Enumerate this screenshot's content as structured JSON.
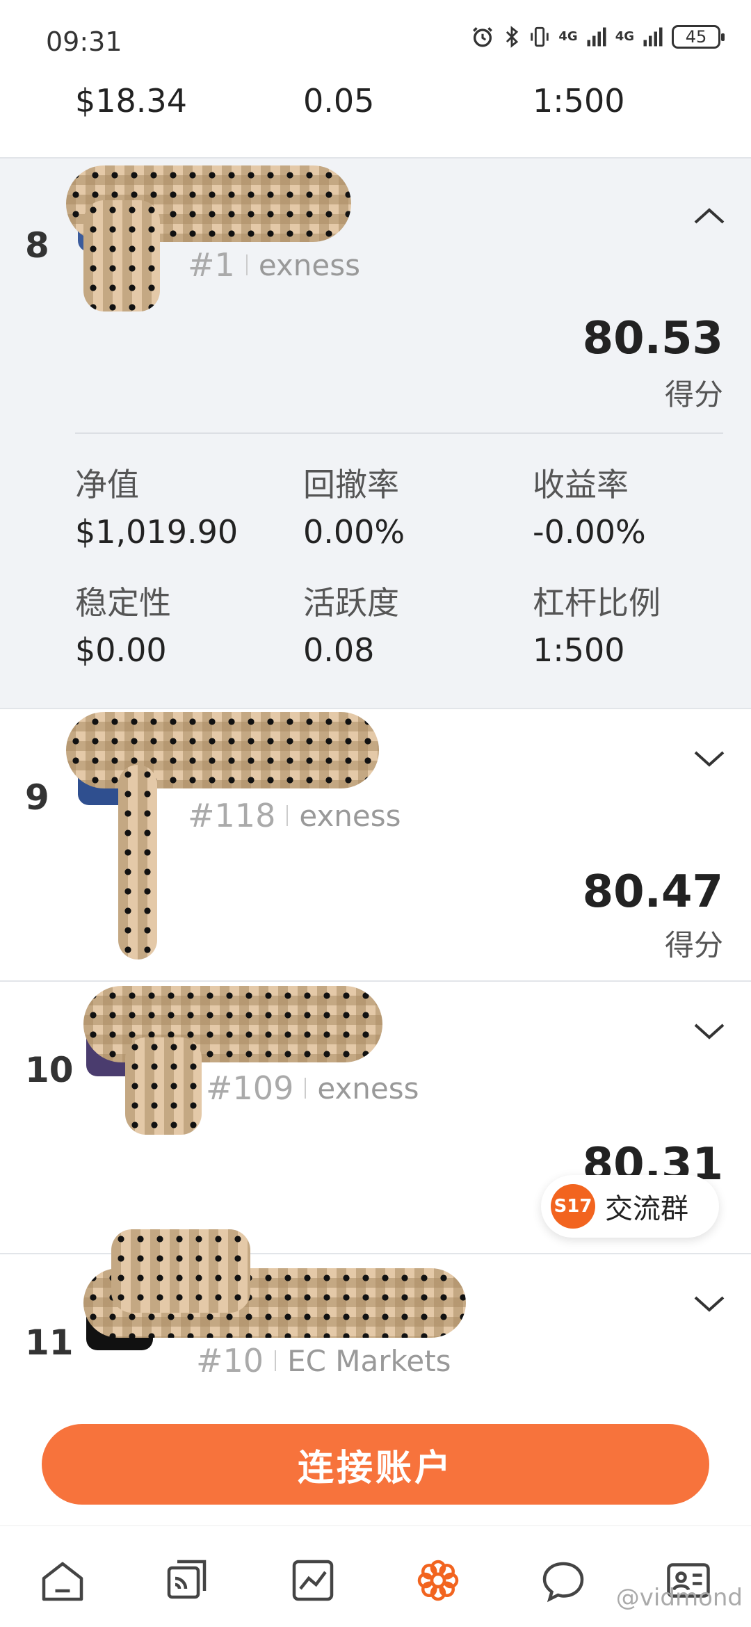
{
  "status_bar": {
    "time": "09:31",
    "network_1": "4G",
    "network_2": "4G",
    "battery": "45"
  },
  "previous_row": {
    "equity": "$18.34",
    "activity": "0.05",
    "leverage": "1:500"
  },
  "cards": [
    {
      "rank": "8",
      "id": "#1",
      "broker": "exness",
      "score": "80.53",
      "score_label": "得分",
      "expanded": true,
      "stats": {
        "equity_label": "净值",
        "equity": "$1,019.90",
        "drawdown_label": "回撤率",
        "drawdown": "0.00%",
        "return_label": "收益率",
        "return": "-0.00%",
        "stability_label": "稳定性",
        "stability": "$0.00",
        "activity_label": "活跃度",
        "activity": "0.08",
        "leverage_label": "杠杆比例",
        "leverage": "1:500"
      }
    },
    {
      "rank": "9",
      "id": "#118",
      "broker": "exness",
      "score": "80.47",
      "score_label": "得分",
      "expanded": false
    },
    {
      "rank": "10",
      "id": "#109",
      "broker": "exness",
      "score": "80.31",
      "expanded": false
    },
    {
      "rank": "11",
      "id": "#10",
      "broker": "EC Markets",
      "expanded": false
    }
  ],
  "float_group": {
    "badge": "S17",
    "label": "交流群"
  },
  "connect_button": {
    "label": "连接账户"
  },
  "nav": [
    "home-icon",
    "cards-icon",
    "chart-icon",
    "discover-icon",
    "chat-icon",
    "profile-icon"
  ],
  "watermark": "@vidmond",
  "colors": {
    "accent": "#f7733c",
    "badge": "#f2641f",
    "expanded_bg": "#f1f3f6"
  }
}
